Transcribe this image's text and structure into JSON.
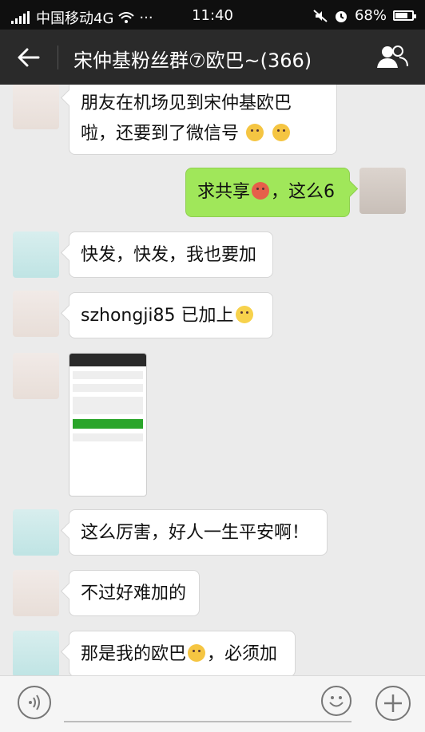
{
  "status_bar": {
    "carrier": "中国移动4G",
    "more": "···",
    "time": "11:40",
    "battery": "68%",
    "battery_level": 0.68
  },
  "nav": {
    "title": "宋仲基粉丝群⑦欧巴~(366)"
  },
  "messages": [
    {
      "side": "left",
      "lines": [
        "朋友在机场见到宋仲基欧巴",
        "啦，还要到了微信号"
      ],
      "emojis": [
        "yellow",
        "yellow"
      ]
    },
    {
      "side": "right",
      "text_before": "求共享",
      "emoji": "red",
      "text_after": "，这么6"
    },
    {
      "side": "left",
      "text": "快发，快发，我也要加"
    },
    {
      "side": "left",
      "text": "szhongji85   已加上",
      "emoji": "smile"
    },
    {
      "side": "left",
      "type": "image"
    },
    {
      "side": "left",
      "text": "这么厉害，好人一生平安啊！"
    },
    {
      "side": "left",
      "text": "不过好难加的"
    },
    {
      "side": "left",
      "text_before": "那是我的欧巴",
      "emoji": "yellow",
      "text_after": "，必须加"
    }
  ]
}
